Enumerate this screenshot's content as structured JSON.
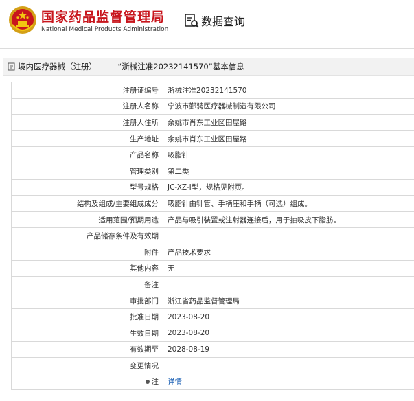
{
  "header": {
    "title_cn": "国家药品监督管理局",
    "title_en": "National Medical Products Administration",
    "data_query_label": "数据查询"
  },
  "section": {
    "title": "境内医疗器械（注册） —— “浙械注准20232141570”基本信息"
  },
  "rows": [
    {
      "label": "注册证编号",
      "value": "浙械注准20232141570"
    },
    {
      "label": "注册人名称",
      "value": "宁波市鄞骋医疗器械制造有限公司"
    },
    {
      "label": "注册人住所",
      "value": "余姚市肖东工业区田屋路"
    },
    {
      "label": "生产地址",
      "value": "余姚市肖东工业区田屋路"
    },
    {
      "label": "产品名称",
      "value": "吸脂针"
    },
    {
      "label": "管理类别",
      "value": "第二类"
    },
    {
      "label": "型号规格",
      "value": "JC-XZ-Ⅰ型，规格见附页。"
    },
    {
      "label": "结构及组成/主要组成成分",
      "value": "吸脂针由针管、手柄座和手柄（可选）组成。"
    },
    {
      "label": "适用范围/预期用途",
      "value": "产品与吸引装置或注射器连接后，用于抽吸皮下脂肪。"
    },
    {
      "label": "产品储存条件及有效期",
      "value": ""
    },
    {
      "label": "附件",
      "value": "产品技术要求"
    },
    {
      "label": "其他内容",
      "value": "无"
    },
    {
      "label": "备注",
      "value": ""
    },
    {
      "label": "审批部门",
      "value": "浙江省药品监督管理局"
    },
    {
      "label": "批准日期",
      "value": "2023-08-20"
    },
    {
      "label": "生效日期",
      "value": "2023-08-20"
    },
    {
      "label": "有效期至",
      "value": "2028-08-19"
    },
    {
      "label": "变更情况",
      "value": ""
    }
  ],
  "note_row": {
    "label": "注",
    "link_text": "详情"
  },
  "colors": {
    "brand_red": "#c8161d",
    "link_blue": "#1a5fb4"
  },
  "icons": [
    "national-emblem-icon",
    "data-query-icon",
    "document-icon",
    "bullet-icon"
  ]
}
